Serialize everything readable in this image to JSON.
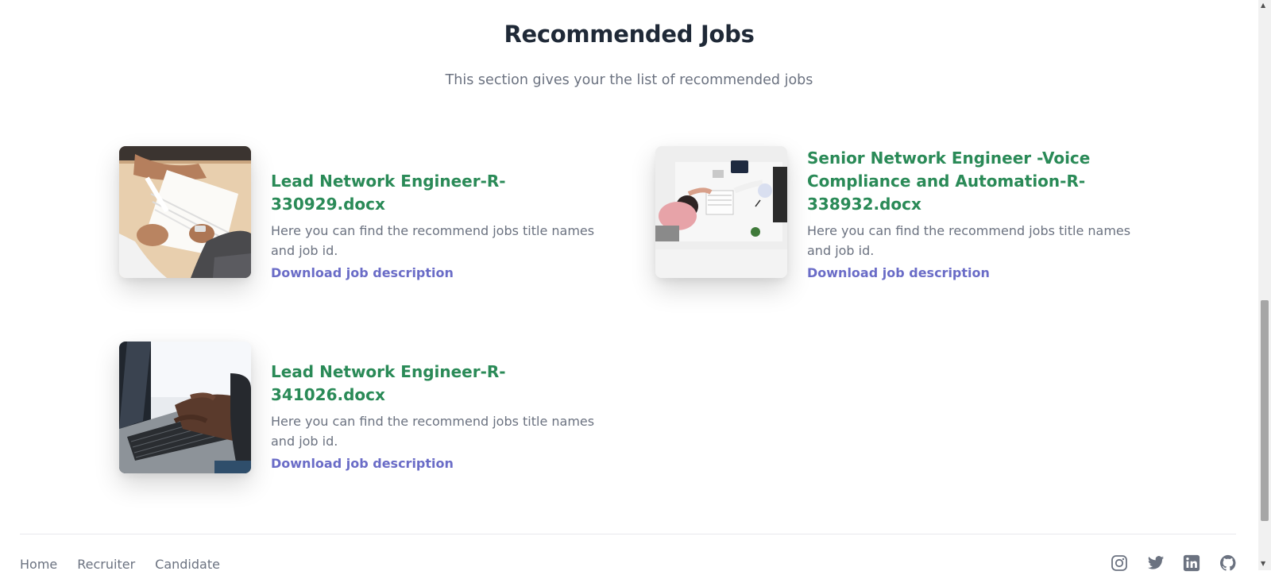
{
  "section": {
    "title": "Recommended Jobs",
    "subtitle": "This section gives your the list of recommended jobs"
  },
  "jobs": [
    {
      "title": "Lead Network Engineer-R-330929.docx",
      "description": "Here you can find the recommend jobs title names and job id.",
      "link": "Download job description",
      "image": "contract-signing-photo"
    },
    {
      "title": "Senior Network Engineer -Voice Compliance and Automation-R-338932.docx",
      "description": "Here you can find the recommend jobs title names and job id.",
      "link": "Download job description",
      "image": "office-handshake-photo"
    },
    {
      "title": "Lead Network Engineer-R-341026.docx",
      "description": "Here you can find the recommend jobs title names and job id.",
      "link": "Download job description",
      "image": "laptop-typing-photo"
    }
  ],
  "footer": {
    "nav": [
      "Home",
      "Recruiter",
      "Candidate"
    ],
    "social": [
      "instagram-icon",
      "twitter-icon",
      "linkedin-icon",
      "github-icon"
    ]
  },
  "colors": {
    "title": "#1f2937",
    "job_title": "#2a8a57",
    "link": "#6a6cc7",
    "muted_text": "#6b7280"
  }
}
